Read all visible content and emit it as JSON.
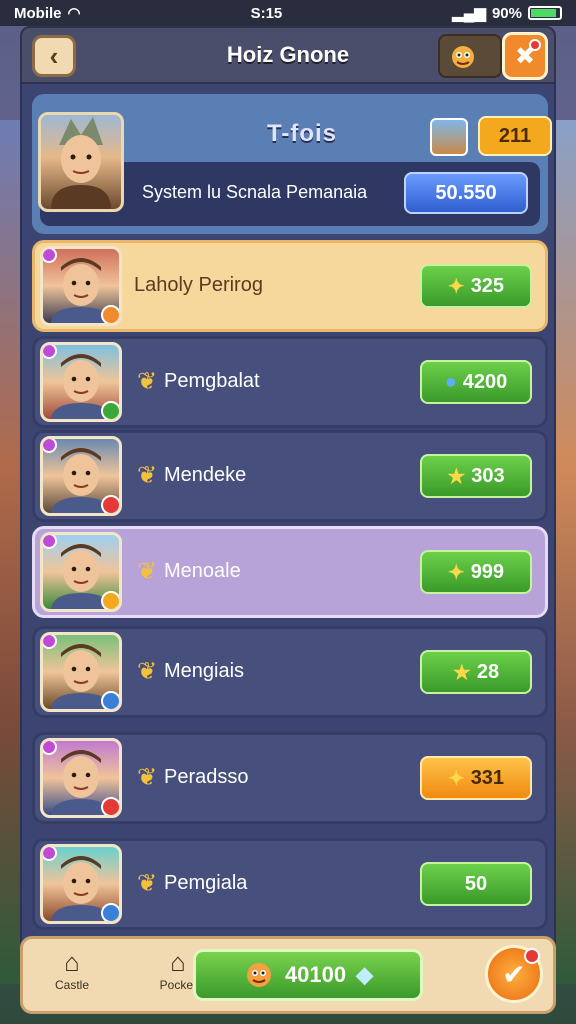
{
  "status_bar": {
    "carrier": "Mobile",
    "time": "S:15",
    "battery": "90%",
    "battery_level": 0.9
  },
  "header": {
    "title": "Hoiz Gnone",
    "back_icon": "chevron-left-icon",
    "action_icon": "wrench-icon"
  },
  "player": {
    "rank_label": "T-fois",
    "points": "211",
    "name": "System lu Scnala Pemanaia",
    "score": "50.550"
  },
  "rows": [
    {
      "name": "Laholy Perirog",
      "score": "325",
      "score_icon": "badge-icon",
      "style": "highlight",
      "score_style": "green",
      "badge_color": "#f08a2a"
    },
    {
      "name": "Pemgbalat",
      "score": "4200",
      "score_icon": "gem-icon",
      "style": "normal",
      "score_style": "green",
      "badge_color": "#3aa83a"
    },
    {
      "name": "Mendeke",
      "score": "303",
      "score_icon": "star-icon",
      "style": "normal",
      "score_style": "green",
      "badge_color": "#e53935"
    },
    {
      "name": "Menoale",
      "score": "999",
      "score_icon": "badge-icon",
      "style": "lilac",
      "score_style": "green",
      "badge_color": "#f3a81e"
    },
    {
      "name": "Mengiais",
      "score": "28",
      "score_icon": "star-icon",
      "style": "normal",
      "score_style": "green",
      "badge_color": "#3a7fd8"
    },
    {
      "name": "Peradsso",
      "score": "331",
      "score_icon": "badge-icon",
      "style": "normal",
      "score_style": "orange",
      "badge_color": "#e53935"
    },
    {
      "name": "Pemgiala",
      "score": "50",
      "score_icon": "",
      "style": "normal",
      "score_style": "green",
      "badge_color": "#3a7fd8"
    }
  ],
  "bottom_bar": {
    "nav": [
      {
        "label": "Castle",
        "icon": "house-icon"
      },
      {
        "label": "Pocket",
        "icon": "house-icon"
      }
    ],
    "balance": "40100",
    "action_icon": "check-icon"
  }
}
